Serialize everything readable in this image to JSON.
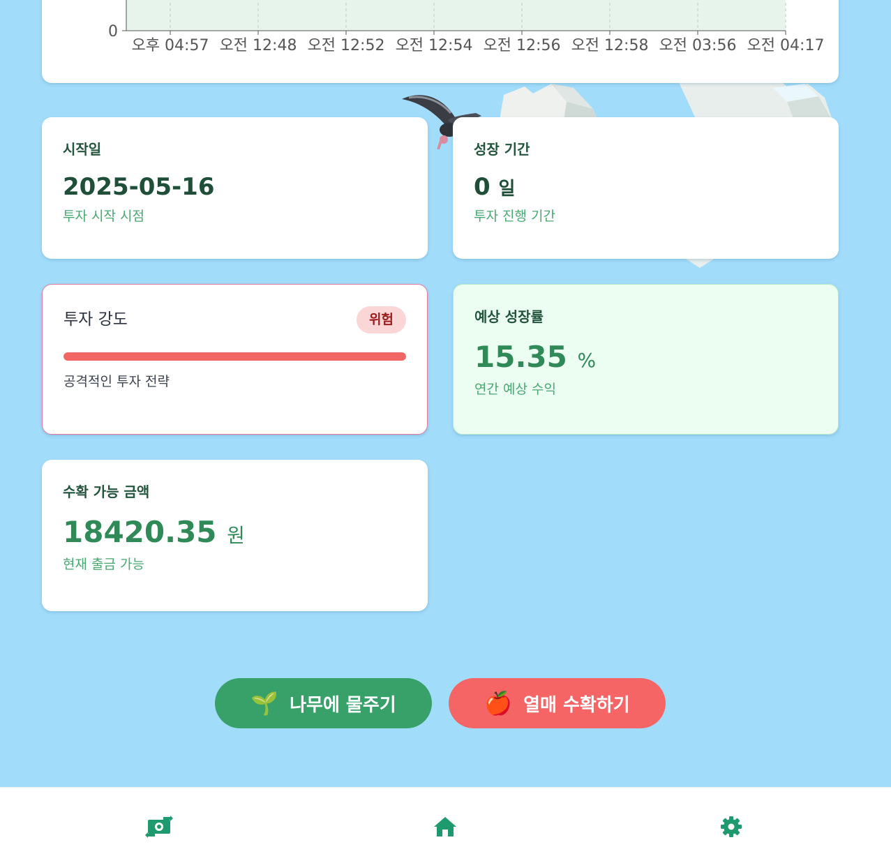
{
  "chart": {
    "y_tick": "0",
    "x_ticks": [
      "오후 04:57",
      "오전 12:48",
      "오전 12:52",
      "오전 12:54",
      "오전 12:56",
      "오전 12:58",
      "오전 03:56",
      "오전 04:17"
    ],
    "fill_color": "#e6f4ec"
  },
  "cards": {
    "start": {
      "label": "시작일",
      "value": "2025-05-16",
      "sub": "투자 시작 시점"
    },
    "period": {
      "label": "성장 기간",
      "value": "0",
      "unit": "일",
      "sub": "투자 진행 기간"
    },
    "risk": {
      "title": "투자 강도",
      "badge": "위험",
      "level_percent": 100,
      "desc": "공격적인 투자 전략"
    },
    "growth": {
      "label": "예상 성장률",
      "value": "15.35",
      "unit": "%",
      "sub": "연간 예상 수익"
    },
    "harvest": {
      "label": "수확 가능 금액",
      "value": "18420.35",
      "unit": "원",
      "sub": "현재 출금 가능"
    }
  },
  "actions": {
    "water_icon": "🌱",
    "water_label": "나무에 물주기",
    "harvest_icon": "🍎",
    "harvest_label": "열매 수확하기"
  },
  "nav": {
    "items": [
      "money-exchange-icon",
      "home-icon",
      "gear-icon"
    ],
    "accent": "#1e9a6e"
  },
  "colors": {
    "background": "#a2dcfb",
    "primary_green": "#38a169",
    "danger_red": "#f56565"
  }
}
